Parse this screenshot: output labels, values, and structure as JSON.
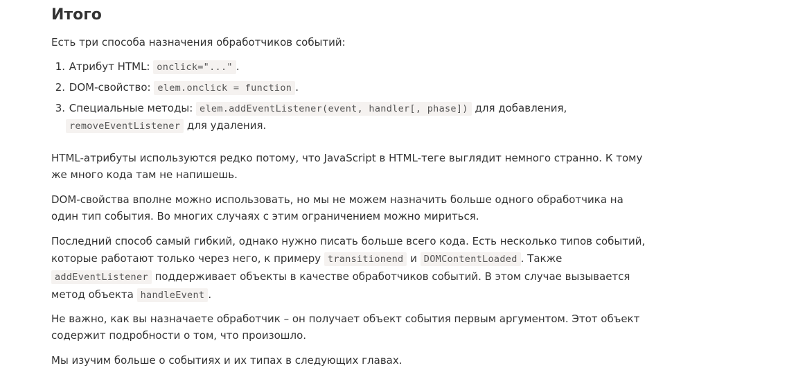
{
  "heading": "Итого",
  "intro": "Есть три способа назначения обработчиков событий:",
  "list": [
    {
      "num": "1.",
      "text_before": "Атрибут HTML:",
      "code": "onclick=\"...\"",
      "text_after": "."
    },
    {
      "num": "2.",
      "text_before": "DOM-свойство:",
      "code": "elem.onclick = function",
      "text_after": "."
    },
    {
      "num": "3.",
      "text_before": "Специальные методы:",
      "code": "elem.addEventListener(event, handler[, phase])",
      "text_after": "для добавления,",
      "code2": "removeEventListener",
      "text_after2": "для удаления."
    }
  ],
  "p1": {
    "line1": "HTML-атрибуты используются редко потому, что JavaScript в HTML-теге выглядит немного странно. К тому",
    "line2": "же много кода там не напишешь."
  },
  "p2": {
    "line1": "DOM-свойства вполне можно использовать, но мы не можем назначить больше одного обработчика на",
    "line2": "один тип события. Во многих случаях с этим ограничением можно мириться."
  },
  "p3": {
    "line1": "Последний способ самый гибкий, однако нужно писать больше всего кода. Есть несколько типов событий,",
    "line2_before": "которые работают только через него, к примеру",
    "code_a": "transitionend",
    "and": "и",
    "code_b": "DOMContentLoaded",
    "line2_after": ". Также",
    "code_c": "addEventListener",
    "line3_after": "поддерживает объекты в качестве обработчиков событий. В этом случае вызывается",
    "line4_before": "метод объекта",
    "code_d": "handleEvent",
    "line4_after": "."
  },
  "p4": {
    "line1": "Не важно, как вы назначаете обработчик – он получает объект события первым аргументом. Этот объект",
    "line2": "содержит подробности о том, что произошло."
  },
  "p5": {
    "line1": "Мы изучим больше о событиях и их типах в следующих главах."
  }
}
